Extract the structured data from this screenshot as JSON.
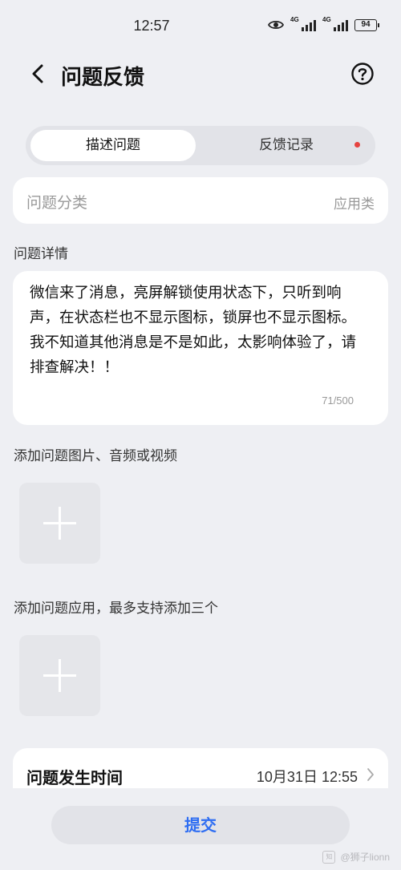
{
  "status_bar": {
    "time": "12:57",
    "network_1": "4G",
    "network_2": "4G",
    "battery": "94"
  },
  "header": {
    "title": "问题反馈"
  },
  "tabs": [
    {
      "label": "描述问题",
      "active": true
    },
    {
      "label": "反馈记录",
      "active": false,
      "has_dot": true
    }
  ],
  "category": {
    "label": "问题分类",
    "value": "应用类"
  },
  "details": {
    "section_label": "问题详情",
    "text": "微信来了消息，亮屏解锁使用状态下，只听到响声，在状态栏也不显示图标，锁屏也不显示图标。我不知道其他消息是不是如此，太影响体验了，请排查解决！！",
    "counter": "71/500"
  },
  "attachments": {
    "section_label": "添加问题图片、音频或视频"
  },
  "apps": {
    "section_label": "添加问题应用，最多支持添加三个"
  },
  "occurrence": {
    "label": "问题发生时间",
    "value": "10月31日 12:55"
  },
  "submit_label": "提交",
  "watermark": "@狮子lionn",
  "colors": {
    "accent": "#2f6ef2",
    "dot": "#e64340",
    "background": "#eeeff3"
  }
}
